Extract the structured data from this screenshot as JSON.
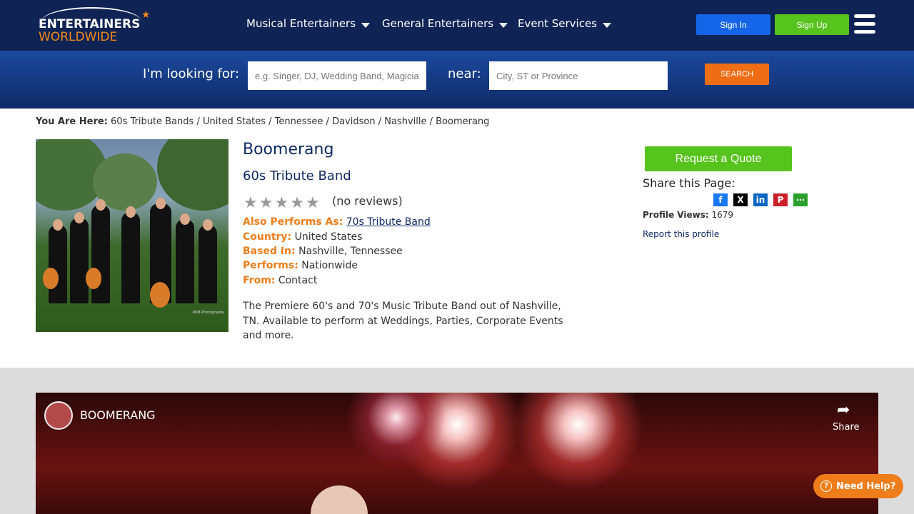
{
  "header": {
    "logo": {
      "line1": "ENTERTAINERS",
      "line2": "WORLDWIDE"
    },
    "nav": [
      {
        "label": "Musical Entertainers"
      },
      {
        "label": "General Entertainers"
      },
      {
        "label": "Event Services"
      }
    ],
    "sign_in": "Sign In",
    "sign_up": "Sign Up",
    "menu_icon": "hamburger-icon"
  },
  "search": {
    "looking_for_label": "I'm looking for:",
    "looking_for_placeholder": "e.g. Singer, DJ, Wedding Band, Magician",
    "near_label": "near:",
    "near_placeholder": "City, ST or Province",
    "button": "SEARCH"
  },
  "breadcrumb": {
    "prefix": "You Are Here:",
    "items": [
      "60s Tribute Bands",
      "United States",
      "Tennessee",
      "Davidson",
      "Nashville",
      "Boomerang"
    ],
    "separator": " / "
  },
  "profile": {
    "name": "Boomerang",
    "type": "60s Tribute Band",
    "rating_stars": 5,
    "rating_value": 0,
    "reviews": "(no reviews)",
    "also_performs_label": "Also Performs As:",
    "also_performs_value": "70s Tribute Band",
    "country_label": "Country:",
    "country_value": "United States",
    "based_label": "Based In:",
    "based_value": "Nashville, Tennessee",
    "performs_label": "Performs:",
    "performs_value": "Nationwide",
    "from_label": "From:",
    "from_value": "Contact",
    "description": "The Premiere 60's and 70's Music Tribute Band out of Nashville, TN. Available to perform at Weddings, Parties, Corporate Events and more."
  },
  "sidebar": {
    "quote_button": "Request a Quote",
    "share_label": "Share this Page:",
    "social": [
      {
        "icon": "facebook-icon",
        "glyph": "f",
        "color": "#1877f2"
      },
      {
        "icon": "x-icon",
        "glyph": "X",
        "color": "#000000"
      },
      {
        "icon": "linkedin-icon",
        "glyph": "in",
        "color": "#0a66c2"
      },
      {
        "icon": "pinterest-icon",
        "glyph": "P",
        "color": "#cb2027"
      },
      {
        "icon": "more-icon",
        "glyph": "⋯",
        "color": "#2ca02c"
      }
    ],
    "views_label": "Profile Views:",
    "views_value": "1679",
    "report": "Report this profile"
  },
  "video": {
    "title": "BOOMERANG",
    "share": "Share"
  },
  "help": "Need Help?",
  "colors": {
    "navy": "#0f2354",
    "orange": "#ef7d1a",
    "green": "#57c41d",
    "blue": "#1565e8"
  }
}
